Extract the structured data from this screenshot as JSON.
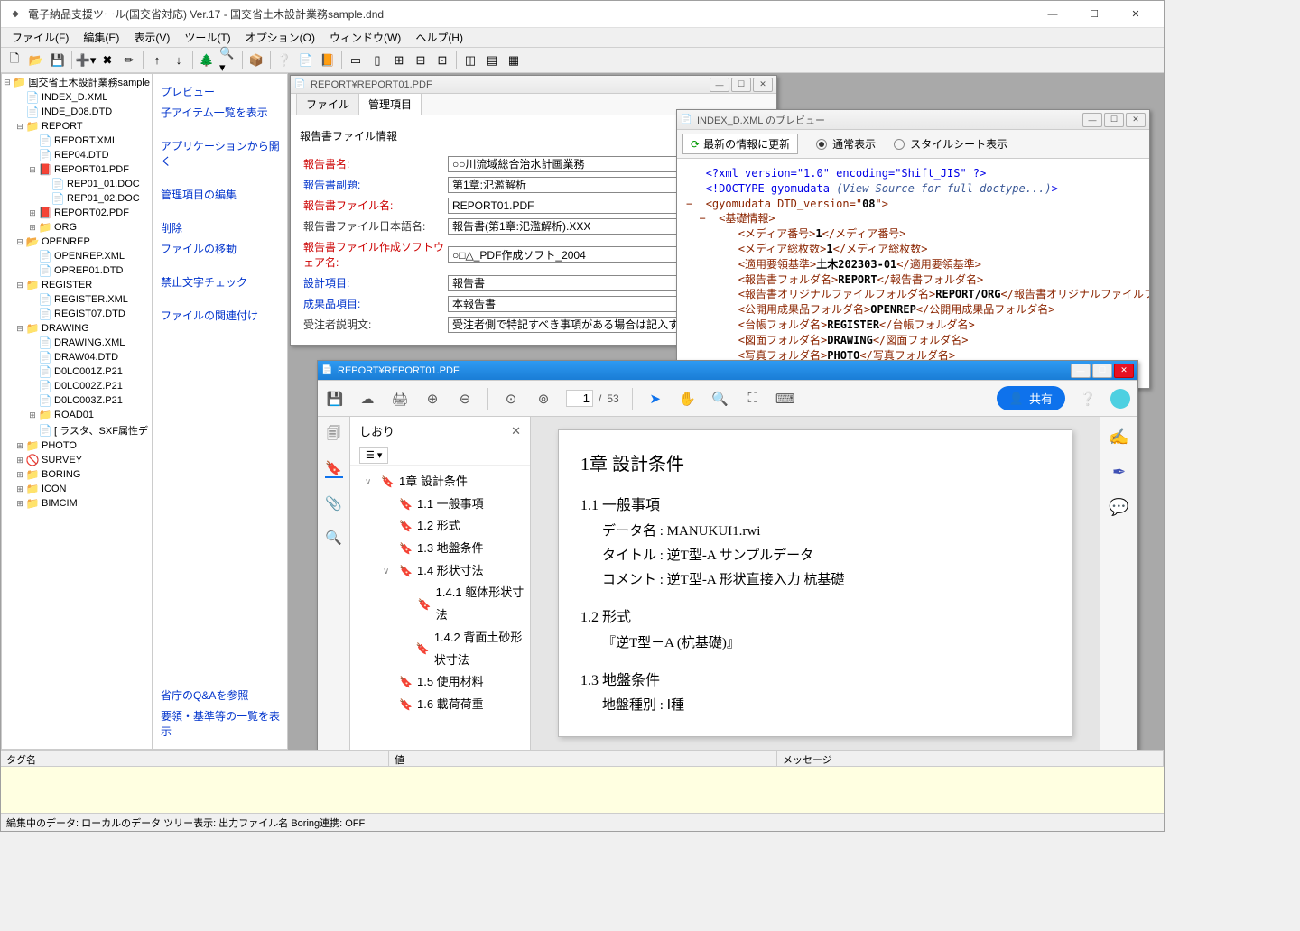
{
  "window": {
    "title": "電子納品支援ツール(国交省対応) Ver.17 - 国交省土木設計業務sample.dnd"
  },
  "menu": [
    "ファイル(F)",
    "編集(E)",
    "表示(V)",
    "ツール(T)",
    "オプション(O)",
    "ウィンドウ(W)",
    "ヘルプ(H)"
  ],
  "tree": [
    {
      "depth": 0,
      "exp": "−",
      "icon": "📁",
      "label": "国交省土木設計業務sample"
    },
    {
      "depth": 1,
      "exp": "",
      "icon": "📄",
      "label": "INDEX_D.XML"
    },
    {
      "depth": 1,
      "exp": "",
      "icon": "📄",
      "label": "INDE_D08.DTD"
    },
    {
      "depth": 1,
      "exp": "−",
      "icon": "📁",
      "label": "REPORT"
    },
    {
      "depth": 2,
      "exp": "",
      "icon": "📄",
      "label": "REPORT.XML"
    },
    {
      "depth": 2,
      "exp": "",
      "icon": "📄",
      "label": "REP04.DTD"
    },
    {
      "depth": 2,
      "exp": "−",
      "icon": "📕",
      "label": "REPORT01.PDF"
    },
    {
      "depth": 3,
      "exp": "",
      "icon": "📄",
      "label": "REP01_01.DOC"
    },
    {
      "depth": 3,
      "exp": "",
      "icon": "📄",
      "label": "REP01_02.DOC"
    },
    {
      "depth": 2,
      "exp": "+",
      "icon": "📕",
      "label": "REPORT02.PDF"
    },
    {
      "depth": 2,
      "exp": "+",
      "icon": "📁",
      "label": "ORG"
    },
    {
      "depth": 1,
      "exp": "−",
      "icon": "📂",
      "label": "OPENREP"
    },
    {
      "depth": 2,
      "exp": "",
      "icon": "📄",
      "label": "OPENREP.XML"
    },
    {
      "depth": 2,
      "exp": "",
      "icon": "📄",
      "label": "OPREP01.DTD"
    },
    {
      "depth": 1,
      "exp": "−",
      "icon": "📁",
      "label": "REGISTER"
    },
    {
      "depth": 2,
      "exp": "",
      "icon": "📄",
      "label": "REGISTER.XML"
    },
    {
      "depth": 2,
      "exp": "",
      "icon": "📄",
      "label": "REGIST07.DTD"
    },
    {
      "depth": 1,
      "exp": "−",
      "icon": "📁",
      "label": "DRAWING"
    },
    {
      "depth": 2,
      "exp": "",
      "icon": "📄",
      "label": "DRAWING.XML"
    },
    {
      "depth": 2,
      "exp": "",
      "icon": "📄",
      "label": "DRAW04.DTD"
    },
    {
      "depth": 2,
      "exp": "",
      "icon": "📄",
      "label": "D0LC001Z.P21"
    },
    {
      "depth": 2,
      "exp": "",
      "icon": "📄",
      "label": "D0LC002Z.P21"
    },
    {
      "depth": 2,
      "exp": "",
      "icon": "📄",
      "label": "D0LC003Z.P21"
    },
    {
      "depth": 2,
      "exp": "+",
      "icon": "📁",
      "label": "ROAD01"
    },
    {
      "depth": 2,
      "exp": "",
      "icon": "📄",
      "label": "[ ラスタ、SXF属性デ"
    },
    {
      "depth": 1,
      "exp": "+",
      "icon": "📁",
      "label": "PHOTO"
    },
    {
      "depth": 1,
      "exp": "+",
      "icon": "🚫",
      "label": "SURVEY"
    },
    {
      "depth": 1,
      "exp": "+",
      "icon": "📁",
      "label": "BORING"
    },
    {
      "depth": 1,
      "exp": "+",
      "icon": "📁",
      "label": "ICON"
    },
    {
      "depth": 1,
      "exp": "+",
      "icon": "📁",
      "label": "BIMCIM"
    }
  ],
  "actions": {
    "items": [
      "プレビュー",
      "子アイテム一覧を表示",
      "",
      "アプリケーションから開く",
      "",
      "管理項目の編集",
      "",
      "削除",
      "ファイルの移動",
      "",
      "禁止文字チェック",
      "",
      "ファイルの関連付け"
    ],
    "bottom": [
      "省庁のQ&Aを参照",
      "要領・基準等の一覧を表示"
    ]
  },
  "win1": {
    "title": "REPORT¥REPORT01.PDF",
    "tabs": [
      "ファイル",
      "管理項目"
    ],
    "active_tab": 1,
    "section": "報告書ファイル情報",
    "rows": [
      {
        "label": "報告書名:",
        "cls": "req",
        "value": "○○川流域総合治水計画業務"
      },
      {
        "label": "報告書副題:",
        "cls": "blue",
        "value": "第1章:氾濫解析"
      },
      {
        "label": "報告書ファイル名:",
        "cls": "req",
        "value": "REPORT01.PDF"
      },
      {
        "label": "報告書ファイル日本語名:",
        "cls": "",
        "value": "報告書(第1章:氾濫解析).XXX"
      },
      {
        "label": "報告書ファイル作成ソフトウェア名:",
        "cls": "req",
        "value": "○□△_PDF作成ソフト_2004"
      },
      {
        "label": "設計項目:",
        "cls": "blue",
        "value": "報告書"
      },
      {
        "label": "成果品項目:",
        "cls": "blue",
        "value": "本報告書"
      },
      {
        "label": "受注者説明文:",
        "cls": "",
        "value": "受注者側で特記すべき事項がある場合は記入する。"
      }
    ]
  },
  "win2": {
    "title": "INDEX_D.XML のプレビュー",
    "refresh": "最新の情報に更新",
    "radios": [
      "通常表示",
      "スタイルシート表示"
    ],
    "radio_checked": 0,
    "xml_first": "<?xml version=\"1.0\" encoding=\"Shift_JIS\" ?>",
    "doctype_head": "<!DOCTYPE gyomudata ",
    "doctype_ital": "(View Source for full doctype...)",
    "doctype_end": ">",
    "root_open": "<gyomudata DTD_version=\"",
    "root_val": "08",
    "root_close": "\">",
    "kiso_tag": "基礎情報",
    "items": [
      {
        "tag": "メディア番号",
        "val": "1"
      },
      {
        "tag": "メディア総枚数",
        "val": "1"
      },
      {
        "tag": "適用要領基準",
        "val": "土木202303-01"
      },
      {
        "tag": "報告書フォルダ名",
        "val": "REPORT"
      },
      {
        "tag": "報告書オリジナルファイルフォルダ名",
        "val": "REPORT/ORG",
        "wrap": "報告書オリジナルファイルフォルダ名"
      },
      {
        "tag": "公開用成果品フォルダ名",
        "val": "OPENREP"
      },
      {
        "tag": "台帳フォルダ名",
        "val": "REGISTER"
      },
      {
        "tag": "図面フォルダ名",
        "val": "DRAWING"
      },
      {
        "tag": "写真フォルダ名",
        "val": "PHOTO"
      }
    ]
  },
  "win3": {
    "title": "REPORT¥REPORT01.PDF",
    "page_current": "1",
    "page_total": "53",
    "share": "共有",
    "outline_title": "しおり",
    "outline": [
      {
        "depth": 1,
        "exp": "∨",
        "label": "1章 設計条件"
      },
      {
        "depth": 2,
        "exp": "",
        "label": "1.1 一般事項"
      },
      {
        "depth": 2,
        "exp": "",
        "label": "1.2 形式"
      },
      {
        "depth": 2,
        "exp": "",
        "label": "1.3 地盤条件"
      },
      {
        "depth": 2,
        "exp": "∨",
        "label": "1.4 形状寸法"
      },
      {
        "depth": 3,
        "exp": "",
        "label": "1.4.1 躯体形状寸法"
      },
      {
        "depth": 3,
        "exp": "",
        "label": "1.4.2 背面土砂形状寸法"
      },
      {
        "depth": 2,
        "exp": "",
        "label": "1.5 使用材料"
      },
      {
        "depth": 2,
        "exp": "",
        "label": "1.6 載荷荷重"
      }
    ],
    "doc": {
      "h1": "1章 設計条件",
      "s11": "1.1 一般事項",
      "s11_lines": [
        "データ名 : MANUKUI1.rwi",
        "タイトル : 逆T型-A サンプルデータ",
        "コメント : 逆T型-A 形状直接入力 杭基礎"
      ],
      "s12": "1.2 形式",
      "s12_line": "『逆T型－A (杭基礎)』",
      "s13": "1.3 地盤条件",
      "s13_line": "地盤種別 :   Ⅰ種"
    }
  },
  "log_cols": [
    "タグ名",
    "値",
    "メッセージ"
  ],
  "status": "編集中のデータ: ローカルのデータ   ツリー表示: 出力ファイル名  Boring連携: OFF"
}
